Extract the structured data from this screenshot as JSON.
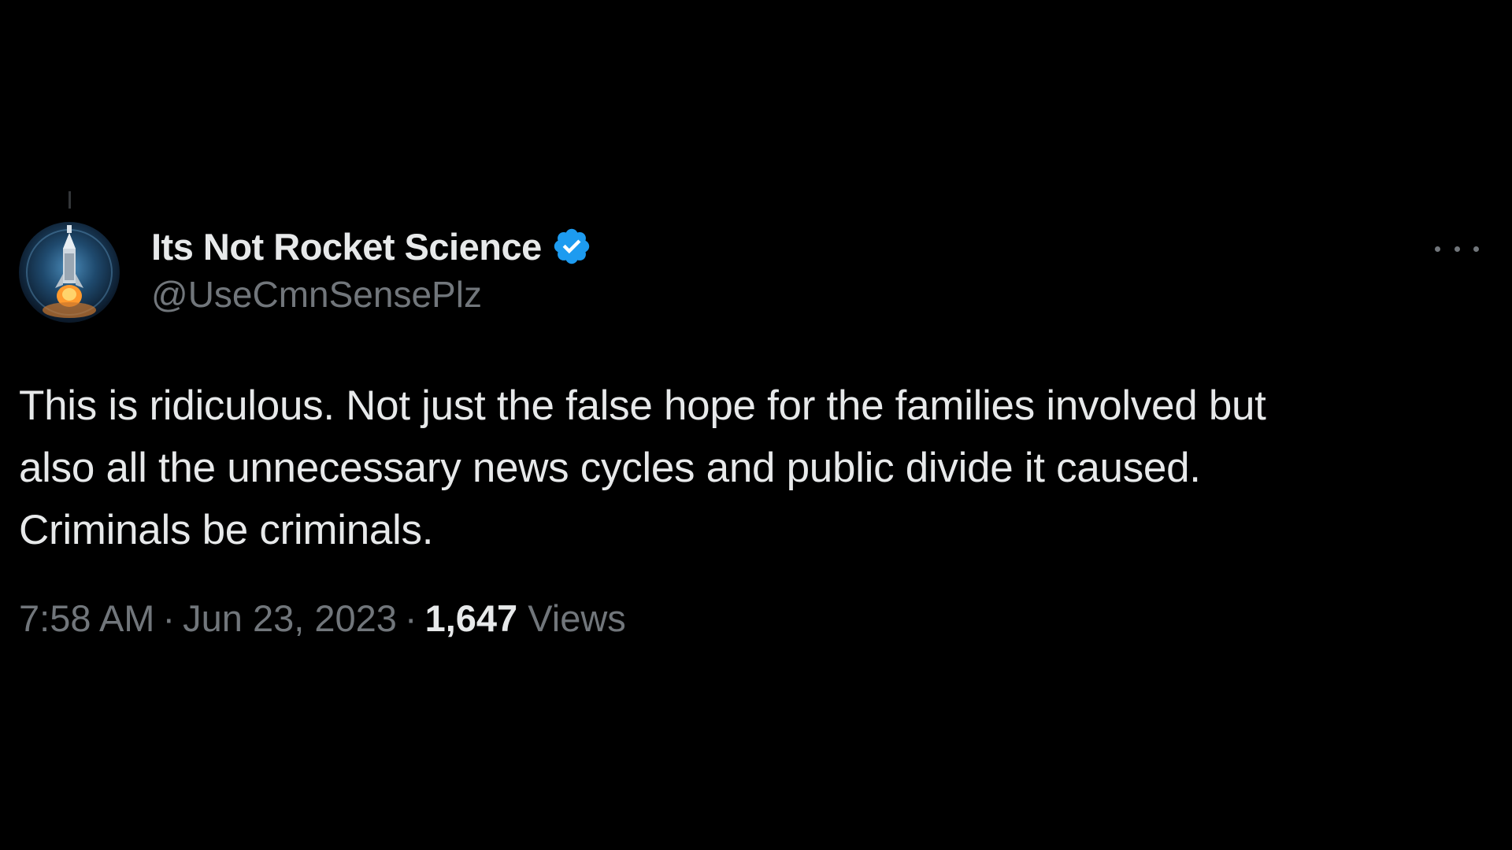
{
  "tweet": {
    "author": {
      "display_name": "Its Not Rocket Science",
      "handle": "@UseCmnSensePlz",
      "verified": true,
      "avatar_icon": "rocket-launch-avatar"
    },
    "more_icon": "ellipsis-icon",
    "text_lines": [
      "This is ridiculous. Not just the false hope for the families involved but",
      "also all the unnecessary news cycles and public divide it caused.",
      "Criminals be criminals."
    ],
    "time": "7:58 AM",
    "date": "Jun 23, 2023",
    "separator": "·",
    "views_count": "1,647",
    "views_label": "Views"
  },
  "colors": {
    "background": "#000000",
    "primary_text": "#e7e9ea",
    "secondary_text": "#71767b",
    "verified_badge": "#1d9bf0"
  }
}
